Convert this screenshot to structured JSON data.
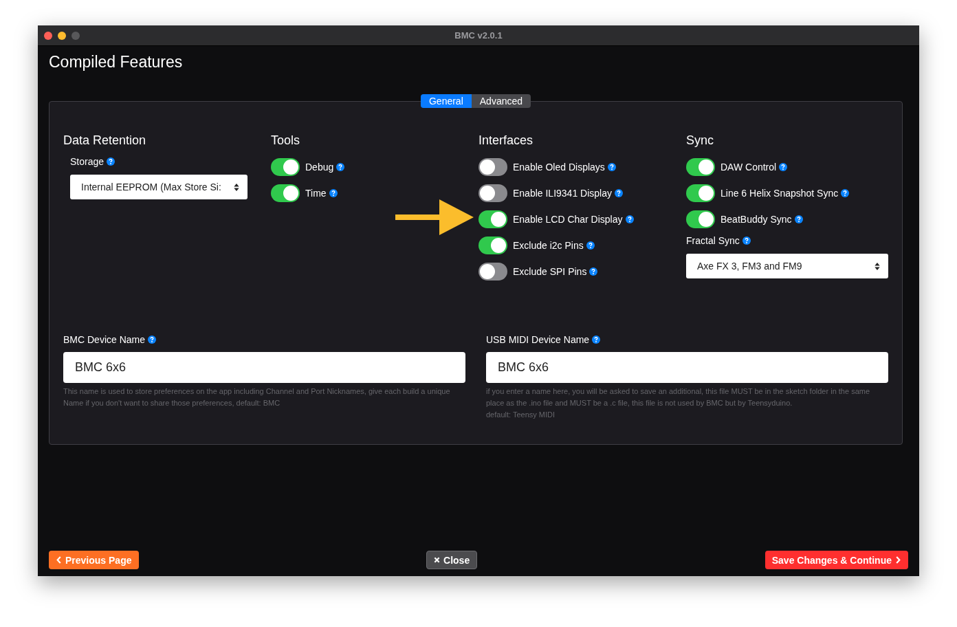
{
  "window": {
    "title": "BMC v2.0.1"
  },
  "heading": "Compiled Features",
  "tabs": [
    {
      "label": "General",
      "selected": true
    },
    {
      "label": "Advanced",
      "selected": false
    }
  ],
  "data_retention": {
    "title": "Data Retention",
    "storage_label": "Storage",
    "storage_value": "Internal EEPROM (Max Store Si:"
  },
  "tools": {
    "title": "Tools",
    "toggles": [
      {
        "label": "Debug",
        "on": true
      },
      {
        "label": "Time",
        "on": true
      }
    ]
  },
  "interfaces": {
    "title": "Interfaces",
    "toggles": [
      {
        "label": "Enable Oled Displays",
        "on": false
      },
      {
        "label": "Enable ILI9341 Display",
        "on": false
      },
      {
        "label": "Enable LCD Char Display",
        "on": true
      },
      {
        "label": "Exclude i2c Pins",
        "on": true
      },
      {
        "label": "Exclude SPI Pins",
        "on": false
      }
    ]
  },
  "sync": {
    "title": "Sync",
    "toggles": [
      {
        "label": "DAW Control",
        "on": true
      },
      {
        "label": "Line 6 Helix Snapshot Sync",
        "on": true
      },
      {
        "label": "BeatBuddy Sync",
        "on": true
      }
    ],
    "fractal_label": "Fractal Sync",
    "fractal_value": "Axe FX 3, FM3 and FM9"
  },
  "fields": [
    {
      "label": "BMC Device Name",
      "value": "BMC 6x6",
      "help": [
        "This name is used to store preferences on the app including Channel and Port Nicknames, give each build a unique Name if you don't want to share those preferences, default: BMC"
      ]
    },
    {
      "label": "USB MIDI Device Name",
      "value": "BMC 6x6",
      "help": [
        "if you enter a name here, you will be asked to save an additional, this file MUST be in the sketch folder in the same place as the .ino file and MUST be a .c file, this file is not used by BMC but by Teensyduino.",
        "default: Teensy MIDI"
      ]
    }
  ],
  "buttons": [
    {
      "label": "Previous Page",
      "kind": "previous"
    },
    {
      "label": "Close",
      "kind": "close"
    },
    {
      "label": "Save Changes & Continue",
      "kind": "save"
    }
  ]
}
